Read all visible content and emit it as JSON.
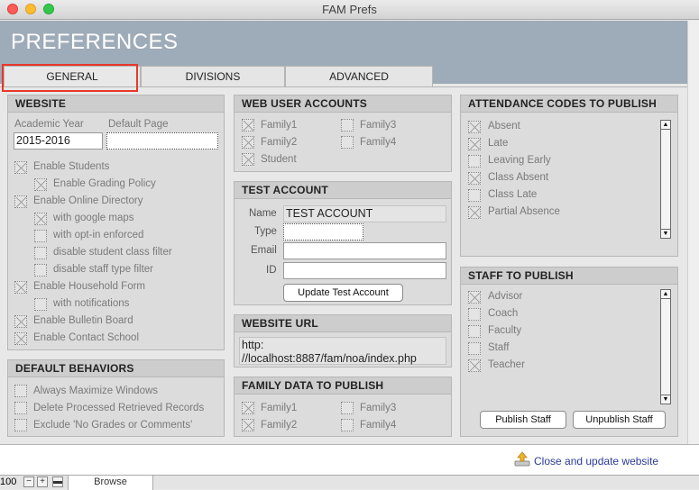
{
  "window": {
    "title": "FAM Prefs"
  },
  "header": {
    "title": "PREFERENCES"
  },
  "tabs": [
    {
      "label": "GENERAL",
      "active": true
    },
    {
      "label": "DIVISIONS",
      "active": false
    },
    {
      "label": "ADVANCED",
      "active": false
    }
  ],
  "website": {
    "heading": "WEBSITE",
    "academic_year_label": "Academic Year",
    "academic_year_value": "2015-2016",
    "default_page_label": "Default Page",
    "default_page_value": "",
    "options": [
      {
        "label": "Enable Students",
        "checked": true
      },
      {
        "label": "Enable Grading Policy",
        "checked": true
      },
      {
        "label": "Enable Online Directory",
        "checked": true
      },
      {
        "label": "with google maps",
        "checked": true
      },
      {
        "label": "with opt-in enforced",
        "checked": false
      },
      {
        "label": "disable student class filter",
        "checked": false
      },
      {
        "label": "disable staff type filter",
        "checked": false
      },
      {
        "label": "Enable Household Form",
        "checked": true
      },
      {
        "label": "with notifications",
        "checked": false
      },
      {
        "label": "Enable Bulletin Board",
        "checked": true
      },
      {
        "label": "Enable Contact School",
        "checked": true
      }
    ]
  },
  "default_behaviors": {
    "heading": "DEFAULT BEHAVIORS",
    "options": [
      {
        "label": "Always Maximize Windows",
        "checked": false
      },
      {
        "label": "Delete Processed Retrieved Records",
        "checked": false
      },
      {
        "label": "Exclude 'No Grades or Comments'",
        "checked": false
      }
    ]
  },
  "web_user_accounts": {
    "heading": "WEB USER ACCOUNTS",
    "options": [
      {
        "label": "Family1",
        "checked": true
      },
      {
        "label": "Family3",
        "checked": false
      },
      {
        "label": "Family2",
        "checked": true
      },
      {
        "label": "Family4",
        "checked": false
      },
      {
        "label": "Student",
        "checked": true
      }
    ]
  },
  "test_account": {
    "heading": "TEST ACCOUNT",
    "name_label": "Name",
    "name_value": "TEST ACCOUNT",
    "type_label": "Type",
    "type_value": "",
    "email_label": "Email",
    "email_value": "",
    "id_label": "ID",
    "id_value": "",
    "update_button": "Update Test Account"
  },
  "website_url": {
    "heading": "WEBSITE URL",
    "line1": "http:",
    "line2": "//localhost:8887/fam/noa/index.php"
  },
  "family_data": {
    "heading": "FAMILY DATA TO PUBLISH",
    "options": [
      {
        "label": "Family1",
        "checked": true
      },
      {
        "label": "Family3",
        "checked": false
      },
      {
        "label": "Family2",
        "checked": true
      },
      {
        "label": "Family4",
        "checked": false
      }
    ]
  },
  "attendance_codes": {
    "heading": "ATTENDANCE CODES TO PUBLISH",
    "options": [
      {
        "label": "Absent",
        "checked": true
      },
      {
        "label": "Late",
        "checked": true
      },
      {
        "label": "Leaving Early",
        "checked": false
      },
      {
        "label": "Class Absent",
        "checked": true
      },
      {
        "label": "Class Late",
        "checked": false
      },
      {
        "label": "Partial Absence",
        "checked": true
      }
    ]
  },
  "staff_to_publish": {
    "heading": "STAFF TO PUBLISH",
    "options": [
      {
        "label": "Advisor",
        "checked": true
      },
      {
        "label": "Coach",
        "checked": false
      },
      {
        "label": "Faculty",
        "checked": false
      },
      {
        "label": "Staff",
        "checked": false
      },
      {
        "label": "Teacher",
        "checked": true
      }
    ],
    "publish_button": "Publish Staff",
    "unpublish_button": "Unpublish Staff"
  },
  "footer": {
    "close_link": "Close and update website"
  },
  "statusbar": {
    "zoom": "100",
    "mode": "Browse"
  },
  "colors": {
    "header_bg": "#9eabb8",
    "tab_highlight": "#e8372a",
    "link": "#2a3a9a"
  }
}
